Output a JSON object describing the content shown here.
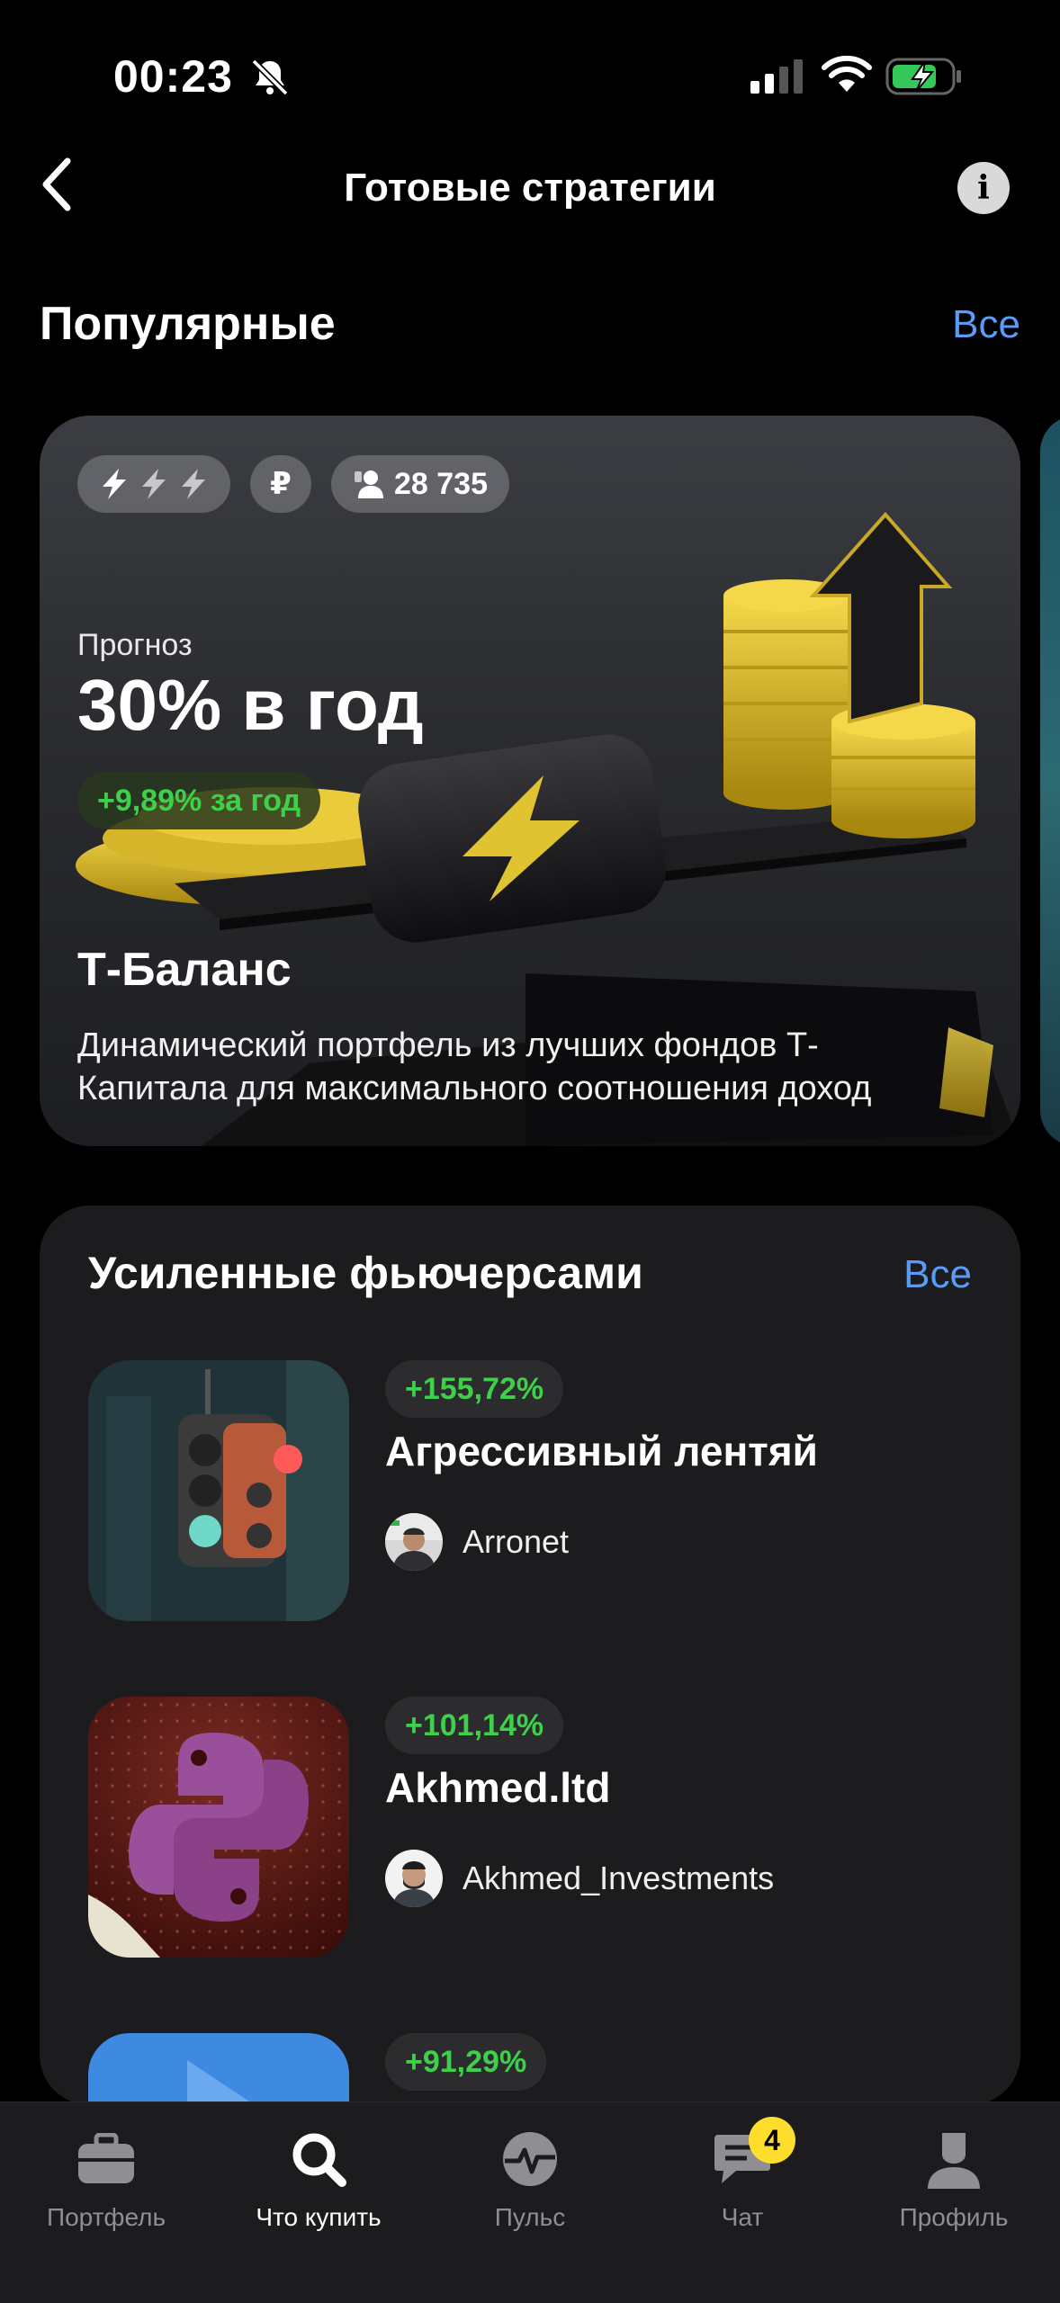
{
  "status_bar": {
    "time": "00:23",
    "icons": [
      "bell-off-icon",
      "signal-icon",
      "wifi-icon",
      "battery-charging-icon"
    ]
  },
  "header": {
    "back_icon": "chevron-left-icon",
    "title": "Готовые стратегии",
    "info_icon": "info-icon",
    "info_glyph": "i"
  },
  "popular": {
    "title": "Популярные",
    "all_label": "Все",
    "card": {
      "risk_icon": "lightning-icon",
      "currency": "₽",
      "subscribers": "28 735",
      "forecast_label": "Прогноз",
      "forecast_value": "30% в год",
      "gain": "+9,89% за год",
      "name": "Т-Баланс",
      "description_line1": "Динамический портфель из лучших фондов Т-",
      "description_line2": "Капитала для максимального соотношения доход"
    }
  },
  "futures": {
    "title": "Усиленные фьючерсами",
    "all_label": "Все",
    "items": [
      {
        "pct": "+155,72%",
        "title": "Агрессивный лентяй",
        "author": "Arronet"
      },
      {
        "pct": "+101,14%",
        "title": "Akhmed.ltd",
        "author": "Akhmed_Investments"
      },
      {
        "pct": "+91,29%",
        "title": "",
        "author": ""
      }
    ]
  },
  "tab_bar": {
    "tabs": [
      {
        "label": "Портфель",
        "icon": "briefcase-icon",
        "active": false
      },
      {
        "label": "Что купить",
        "icon": "search-icon",
        "active": true
      },
      {
        "label": "Пульс",
        "icon": "pulse-icon",
        "active": false
      },
      {
        "label": "Чат",
        "icon": "chat-icon",
        "active": false,
        "badge": "4"
      },
      {
        "label": "Профиль",
        "icon": "profile-icon",
        "active": false
      }
    ]
  },
  "colors": {
    "background": "#000000",
    "card": "#1c1c1e",
    "accent_link": "#5a9cf5",
    "gain_green": "#3fd04b",
    "badge_yellow": "#ffdd2d"
  }
}
